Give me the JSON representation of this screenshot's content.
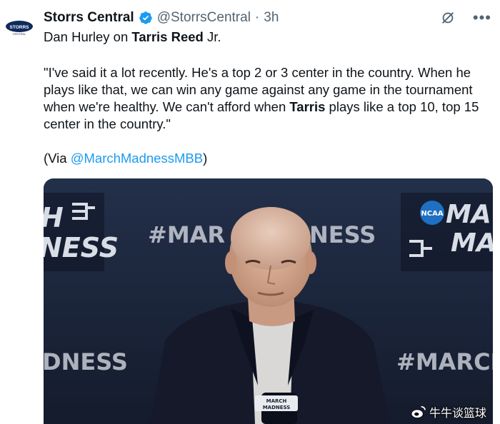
{
  "tweet": {
    "author_name": "Storrs Central",
    "handle": "@StorrsCentral",
    "separator": "·",
    "time": "3h",
    "line1_prefix": "Dan Hurley on ",
    "line1_bold": "Tarris Reed",
    "line1_suffix": " Jr.",
    "quote_part1": "\"I've said it a lot recently. He's a top 2 or 3 center in the country. When he plays like that, we can win any game against any game in the tournament when we're healthy. We can't afford when ",
    "quote_bold": "Tarris",
    "quote_part2": " plays like a top 10, top 15 center in the country.\"",
    "via_prefix": "(Via ",
    "via_mention": "@MarchMadnessMBB",
    "via_suffix": ")"
  },
  "avatar": {
    "text": "STORRS",
    "subtext": "CENTRAL"
  },
  "media": {
    "backdrop_left_top": "H",
    "backdrop_left_mid": "NESS",
    "backdrop_center": "#MAR",
    "backdrop_center2": "NESS",
    "backdrop_right_top": "MA",
    "backdrop_right_mid": "MA",
    "backdrop_ncaa": "NCAA",
    "backdrop_bottom_left": "DNESS",
    "backdrop_bottom_right": "#MARCH",
    "mic_label_1": "MARCH",
    "mic_label_2": "MADNESS"
  },
  "watermark": {
    "text": "牛牛谈篮球"
  },
  "colors": {
    "link": "#1d9bf0",
    "verified": "#1d9bf0",
    "secondary": "#536471",
    "backdrop": "#1a2236"
  },
  "icons": [
    "verified-badge-icon",
    "grok-icon",
    "more-icon",
    "weibo-icon"
  ]
}
